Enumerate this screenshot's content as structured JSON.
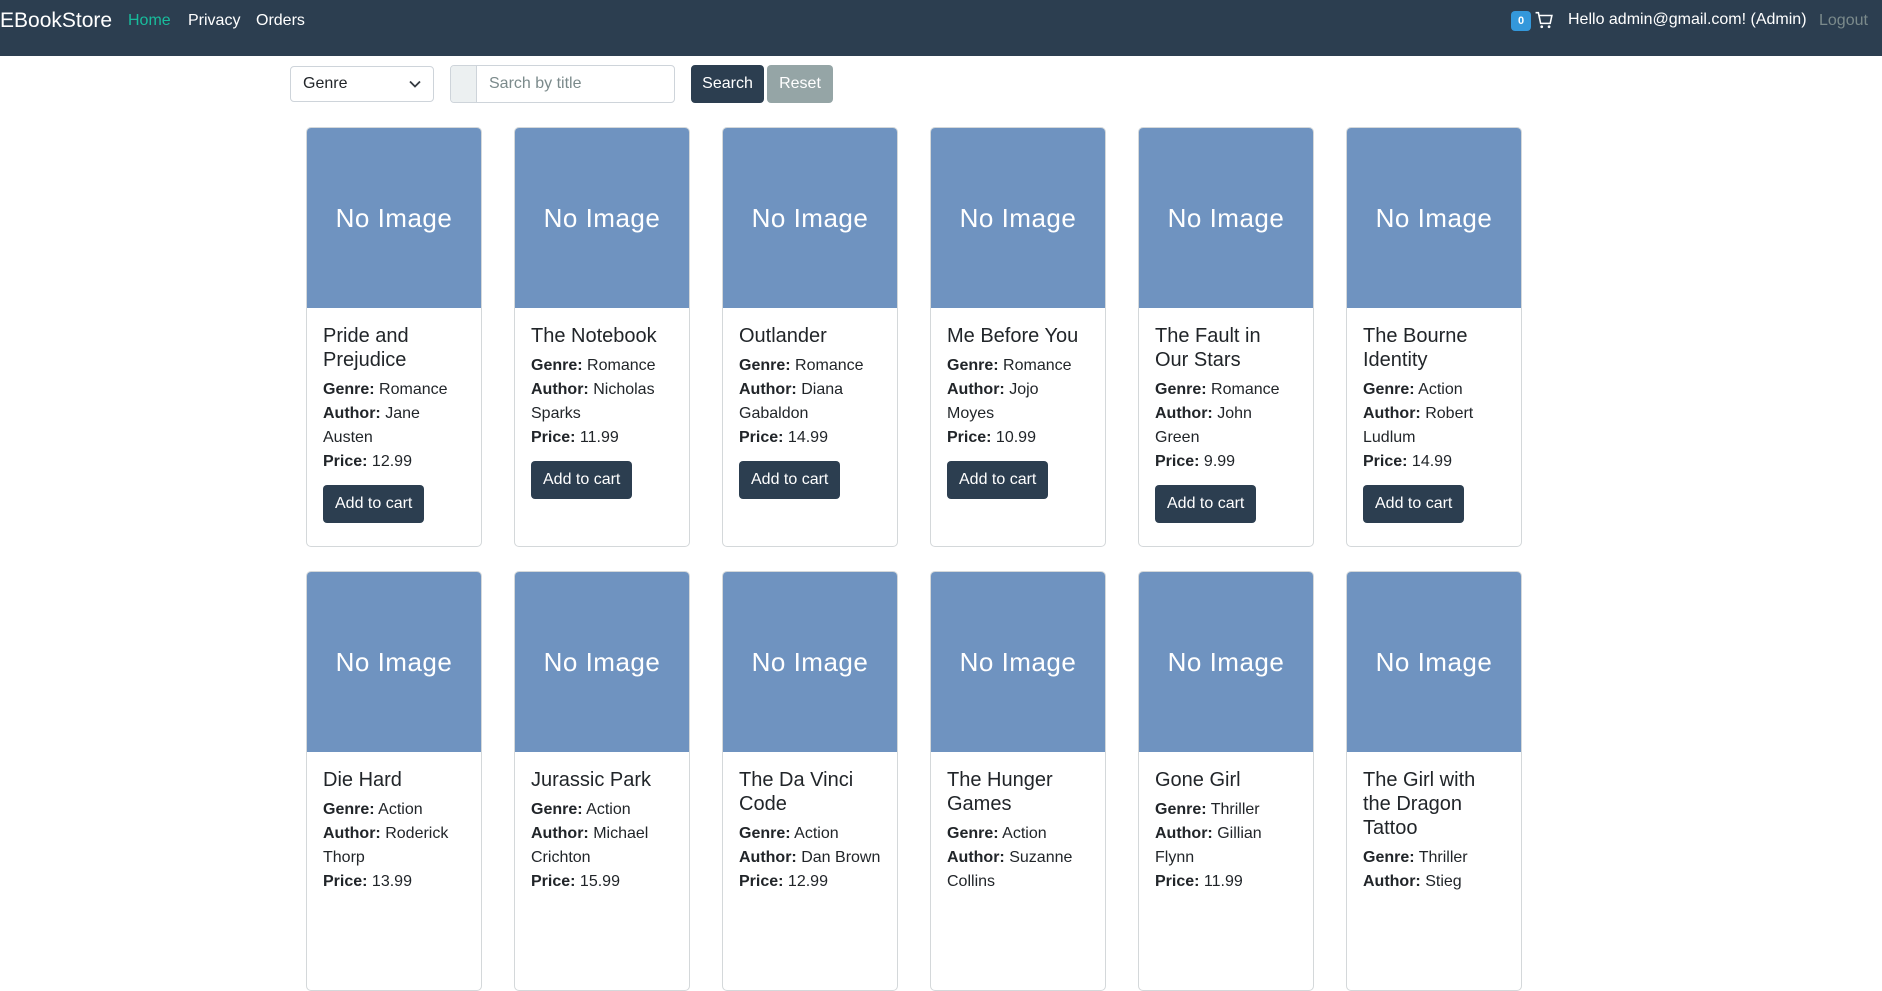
{
  "navbar": {
    "brand": "EBookStore",
    "links": [
      {
        "label": "Home",
        "active": true
      },
      {
        "label": "Privacy",
        "active": false
      },
      {
        "label": "Orders",
        "active": false
      }
    ],
    "cart_count": "0",
    "greeting": "Hello admin@gmail.com! (Admin)",
    "logout": "Logout"
  },
  "filters": {
    "genre_selected": "Genre",
    "search_placeholder": "Sarch by title",
    "search_label": "Search",
    "reset_label": "Reset"
  },
  "labels": {
    "no_image": "No Image",
    "genre": "Genre:",
    "author": "Author:",
    "price": "Price:",
    "add_to_cart": "Add to cart"
  },
  "books": [
    {
      "title": "Pride and Prejudice",
      "genre": "Romance",
      "author": "Jane Austen",
      "price": "12.99"
    },
    {
      "title": "The Notebook",
      "genre": "Romance",
      "author": "Nicholas Sparks",
      "price": "11.99"
    },
    {
      "title": "Outlander",
      "genre": "Romance",
      "author": "Diana Gabaldon",
      "price": "14.99"
    },
    {
      "title": "Me Before You",
      "genre": "Romance",
      "author": "Jojo Moyes",
      "price": "10.99"
    },
    {
      "title": "The Fault in Our Stars",
      "genre": "Romance",
      "author": "John Green",
      "price": "9.99"
    },
    {
      "title": "The Bourne Identity",
      "genre": "Action",
      "author": "Robert Ludlum",
      "price": "14.99"
    },
    {
      "title": "Die Hard",
      "genre": "Action",
      "author": "Roderick Thorp",
      "price": "13.99"
    },
    {
      "title": "Jurassic Park",
      "genre": "Action",
      "author": "Michael Crichton",
      "price": "15.99"
    },
    {
      "title": "The Da Vinci Code",
      "genre": "Action",
      "author": "Dan Brown",
      "price": "12.99"
    },
    {
      "title": "The Hunger Games",
      "genre": "Action",
      "author": "Suzanne Collins",
      "price": ""
    },
    {
      "title": "Gone Girl",
      "genre": "Thriller",
      "author": "Gillian Flynn",
      "price": "11.99"
    },
    {
      "title": "The Girl with the Dragon Tattoo",
      "genre": "Thriller",
      "author": "Stieg",
      "price": ""
    }
  ]
}
